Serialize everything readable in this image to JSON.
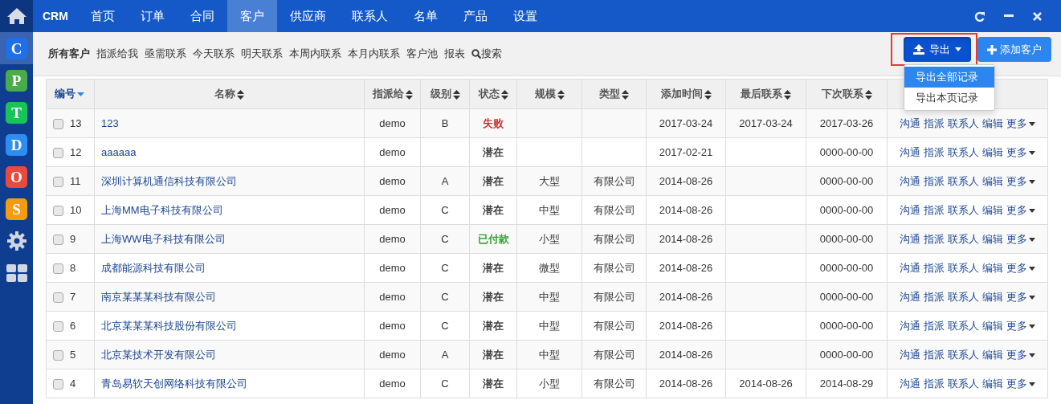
{
  "topbar": {
    "brand": "CRM",
    "tabs": [
      {
        "label": "首页",
        "selected": false
      },
      {
        "label": "订单",
        "selected": false
      },
      {
        "label": "合同",
        "selected": false
      },
      {
        "label": "客户",
        "selected": true
      },
      {
        "label": "供应商",
        "selected": false
      },
      {
        "label": "联系人",
        "selected": false
      },
      {
        "label": "名单",
        "selected": false
      },
      {
        "label": "产品",
        "selected": false
      },
      {
        "label": "设置",
        "selected": false
      }
    ]
  },
  "sidebar": {
    "apps": [
      {
        "letter": "C",
        "color": "#1f6fe8",
        "selected": true
      },
      {
        "letter": "P",
        "color": "#4aab4a",
        "selected": false
      },
      {
        "letter": "T",
        "color": "#17c45a",
        "selected": false
      },
      {
        "letter": "D",
        "color": "#2c8ef0",
        "selected": false
      },
      {
        "letter": "O",
        "color": "#e84a3c",
        "selected": false
      },
      {
        "letter": "S",
        "color": "#f39c12",
        "selected": false
      }
    ]
  },
  "subnav": {
    "items": [
      {
        "label": "所有客户",
        "selected": true
      },
      {
        "label": "指派给我",
        "selected": false
      },
      {
        "label": "亟需联系",
        "selected": false
      },
      {
        "label": "今天联系",
        "selected": false
      },
      {
        "label": "明天联系",
        "selected": false
      },
      {
        "label": "本周内联系",
        "selected": false
      },
      {
        "label": "本月内联系",
        "selected": false
      },
      {
        "label": "客户池",
        "selected": false
      },
      {
        "label": "报表",
        "selected": false
      }
    ],
    "search": "搜索",
    "export_button": {
      "label": "导出",
      "highlighted": true,
      "expanded": true,
      "menu": [
        {
          "label": "导出全部记录",
          "selected": true
        },
        {
          "label": "导出本页记录",
          "selected": false
        }
      ]
    },
    "add_button": "添加客户"
  },
  "table": {
    "columns": [
      {
        "label": "编号",
        "sorted": true
      },
      {
        "label": "名称",
        "sorted": false
      },
      {
        "label": "指派给",
        "sorted": false
      },
      {
        "label": "级别",
        "sorted": false
      },
      {
        "label": "状态",
        "sorted": false
      },
      {
        "label": "规模",
        "sorted": false
      },
      {
        "label": "类型",
        "sorted": false
      },
      {
        "label": "添加时间",
        "sorted": false
      },
      {
        "label": "最后联系",
        "sorted": false
      },
      {
        "label": "下次联系",
        "sorted": false
      }
    ],
    "rows": [
      {
        "checked": false,
        "id": "13",
        "name": "123",
        "assigned": "demo",
        "level": "B",
        "status": {
          "text": "失败",
          "color": "#d22222"
        },
        "scale": "",
        "type": "",
        "added": "2017-03-24",
        "last": "2017-03-24",
        "next": "2017-03-26",
        "actions": [
          "沟通",
          "指派",
          "联系人",
          "编辑",
          "更多"
        ]
      },
      {
        "checked": false,
        "id": "12",
        "name": "aaaaaa",
        "assigned": "demo",
        "level": "",
        "status": {
          "text": "潜在",
          "color": "#333333"
        },
        "scale": "",
        "type": "",
        "added": "2017-02-21",
        "last": "",
        "next": "0000-00-00",
        "actions": [
          "沟通",
          "指派",
          "联系人",
          "编辑",
          "更多"
        ]
      },
      {
        "checked": false,
        "id": "11",
        "name": "深圳计算机通信科技有限公司",
        "assigned": "demo",
        "level": "A",
        "status": {
          "text": "潜在",
          "color": "#333333"
        },
        "scale": "大型",
        "type": "有限公司",
        "added": "2014-08-26",
        "last": "",
        "next": "0000-00-00",
        "actions": [
          "沟通",
          "指派",
          "联系人",
          "编辑",
          "更多"
        ]
      },
      {
        "checked": false,
        "id": "10",
        "name": "上海MM电子科技有限公司",
        "assigned": "demo",
        "level": "C",
        "status": {
          "text": "潜在",
          "color": "#333333"
        },
        "scale": "中型",
        "type": "有限公司",
        "added": "2014-08-26",
        "last": "",
        "next": "0000-00-00",
        "actions": [
          "沟通",
          "指派",
          "联系人",
          "编辑",
          "更多"
        ]
      },
      {
        "checked": false,
        "id": "9",
        "name": "上海WW电子科技有限公司",
        "assigned": "demo",
        "level": "C",
        "status": {
          "text": "已付款",
          "color": "#2a9a2a"
        },
        "scale": "小型",
        "type": "有限公司",
        "added": "2014-08-26",
        "last": "",
        "next": "0000-00-00",
        "actions": [
          "沟通",
          "指派",
          "联系人",
          "编辑",
          "更多"
        ]
      },
      {
        "checked": false,
        "id": "8",
        "name": "成都能源科技有限公司",
        "assigned": "demo",
        "level": "C",
        "status": {
          "text": "潜在",
          "color": "#333333"
        },
        "scale": "微型",
        "type": "有限公司",
        "added": "2014-08-26",
        "last": "",
        "next": "0000-00-00",
        "actions": [
          "沟通",
          "指派",
          "联系人",
          "编辑",
          "更多"
        ]
      },
      {
        "checked": false,
        "id": "7",
        "name": "南京某某某科技有限公司",
        "assigned": "demo",
        "level": "C",
        "status": {
          "text": "潜在",
          "color": "#333333"
        },
        "scale": "中型",
        "type": "有限公司",
        "added": "2014-08-26",
        "last": "",
        "next": "0000-00-00",
        "actions": [
          "沟通",
          "指派",
          "联系人",
          "编辑",
          "更多"
        ]
      },
      {
        "checked": false,
        "id": "6",
        "name": "北京某某某科技股份有限公司",
        "assigned": "demo",
        "level": "C",
        "status": {
          "text": "潜在",
          "color": "#333333"
        },
        "scale": "中型",
        "type": "有限公司",
        "added": "2014-08-26",
        "last": "",
        "next": "0000-00-00",
        "actions": [
          "沟通",
          "指派",
          "联系人",
          "编辑",
          "更多"
        ]
      },
      {
        "checked": false,
        "id": "5",
        "name": "北京某技术开发有限公司",
        "assigned": "demo",
        "level": "A",
        "status": {
          "text": "潜在",
          "color": "#333333"
        },
        "scale": "中型",
        "type": "有限公司",
        "added": "2014-08-26",
        "last": "",
        "next": "0000-00-00",
        "actions": [
          "沟通",
          "指派",
          "联系人",
          "编辑",
          "更多"
        ]
      },
      {
        "checked": false,
        "id": "4",
        "name": "青岛易软天创网络科技有限公司",
        "assigned": "demo",
        "level": "C",
        "status": {
          "text": "潜在",
          "color": "#333333"
        },
        "scale": "小型",
        "type": "有限公司",
        "added": "2014-08-26",
        "last": "2014-08-26",
        "next": "2014-08-29",
        "actions": [
          "沟通",
          "指派",
          "联系人",
          "编辑",
          "更多"
        ]
      }
    ]
  }
}
